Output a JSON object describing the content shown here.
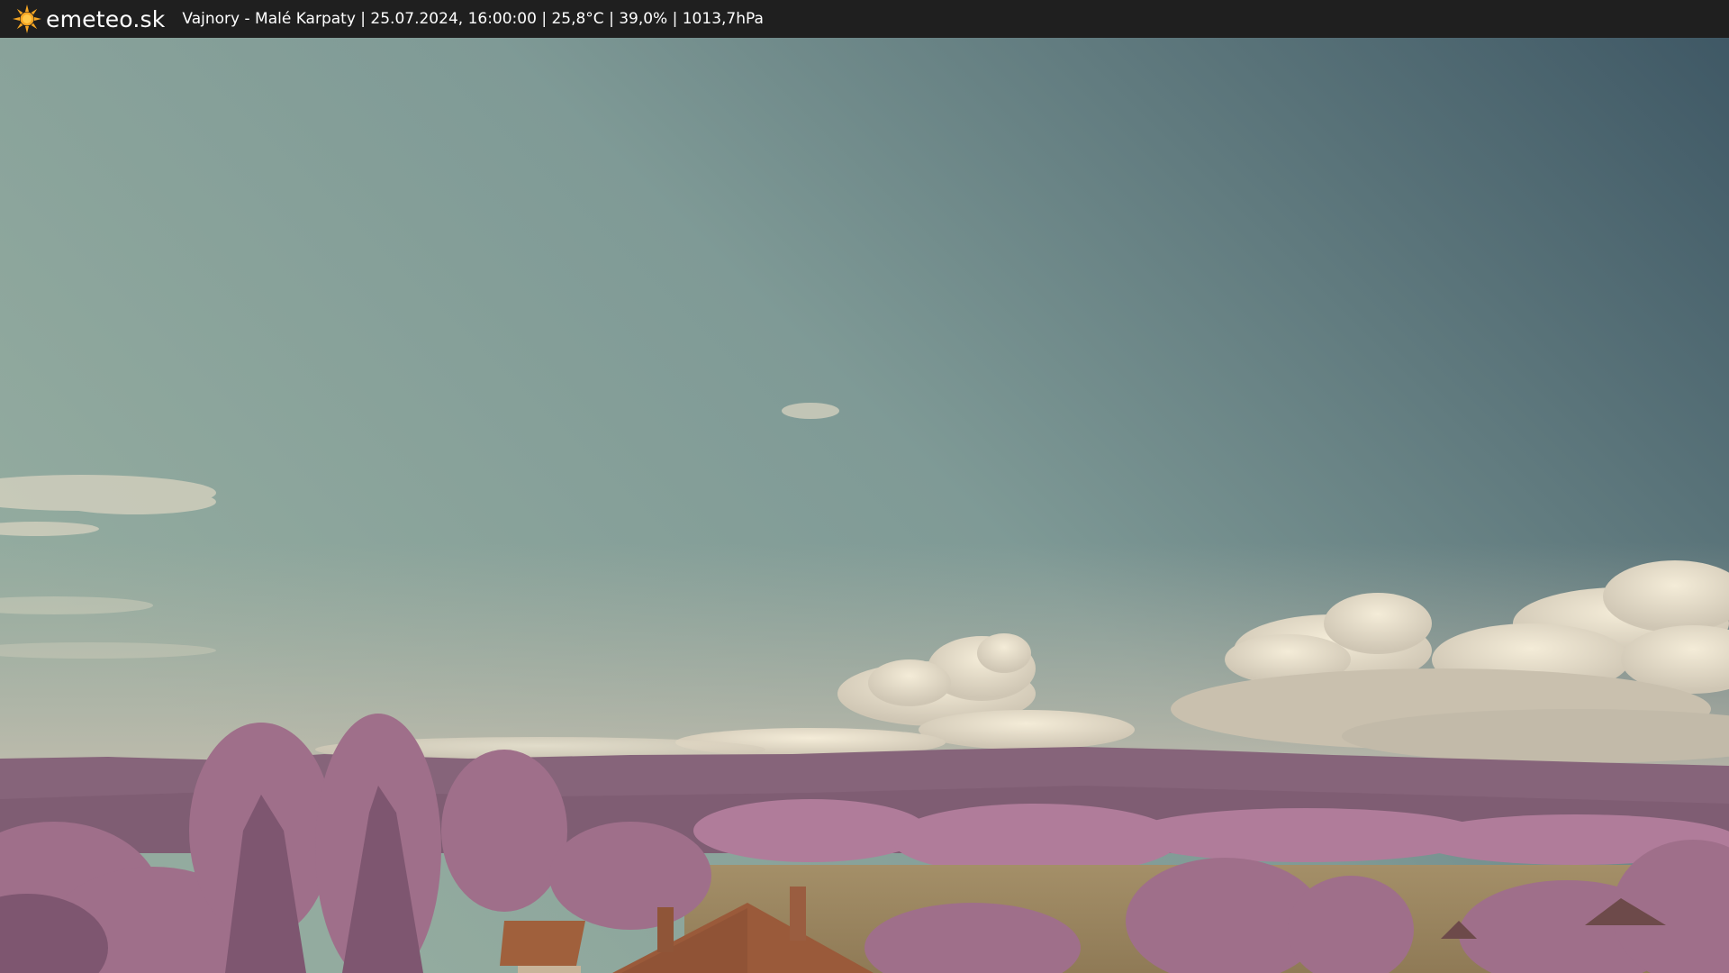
{
  "header": {
    "brand": "emeteo.sk",
    "caption": "Vajnory - Malé Karpaty | 25.07.2024, 16:00:00 | 25,8°C | 39,0% | 1013,7hPa",
    "logo_icon": "sun-icon",
    "background": "#1f1f1f",
    "text_color": "#ffffff",
    "sun_color": "#f5a623"
  },
  "scene": {
    "description_icon": "webcam-image",
    "sky_top_right": "#3f5865",
    "sky_left": "#8aa79e",
    "haze": "#b9b7a8",
    "hills": "#8a6378",
    "foliage": "#b07a98",
    "field": "#9e8a62",
    "roof": "#9a5a3a"
  }
}
